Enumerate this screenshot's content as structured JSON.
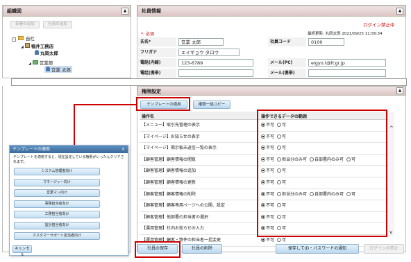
{
  "left_panel": {
    "title": "組織図",
    "buttons": [
      "部署の追加",
      "社員の追加"
    ],
    "tree": [
      {
        "label": "自社"
      },
      {
        "label": "福井工務店"
      },
      {
        "label": "丸岡太郎"
      },
      {
        "label": "営業部"
      },
      {
        "label": "営業 太郎"
      }
    ]
  },
  "employee_info": {
    "title": "社員情報",
    "login_status": "ログイン禁止中",
    "required_note": "*: 必須",
    "last_updated": "最終更新: 丸岡太郎 2021/09/25 11:56:34",
    "fields": {
      "name_label": "氏名*",
      "name_value": "営業 太郎",
      "employee_code_label": "社員コード",
      "employee_code_value": "0100",
      "furigana_label": "フリガナ",
      "furigana_value": "エイギョウ タロウ",
      "phone_internal_label": "電話(内線)",
      "phone_internal_value": "123-6789",
      "mail_pc_label": "メール(PC)",
      "mail_pc_value": "eigyo.t@fcgr.jp",
      "phone_mobile_label": "電話(携帯)",
      "phone_mobile_value": "",
      "mail_mobile_label": "メール(携帯)",
      "mail_mobile_value": ""
    }
  },
  "permissions": {
    "title": "権限設定",
    "apply_template_button": "テンプレートの適用",
    "bulk_copy_button": "権限一括コピー",
    "col_operation": "操作名",
    "col_scope": "操作できるデータの範囲",
    "rows": [
      {
        "name": "【メニュー】取引先管理の表示",
        "options": [
          "不可",
          "可"
        ],
        "selected": 0
      },
      {
        "name": "【マイページ】お知らせの表示",
        "options": [
          "不可",
          "可"
        ],
        "selected": 0
      },
      {
        "name": "【マイページ】掲示板未返信一覧の表示",
        "options": [
          "不可",
          "可"
        ],
        "selected": 0
      },
      {
        "name": "【顧客管理】顧客情報の閲覧",
        "options": [
          "不可",
          "担当分のみ可",
          "自部署内のみ可",
          "可"
        ],
        "selected": 0
      },
      {
        "name": "【顧客管理】顧客情報の追加",
        "options": [
          "不可",
          "可"
        ],
        "selected": 0
      },
      {
        "name": "【顧客管理】顧客情報の更新",
        "options": [
          "不可",
          "可"
        ],
        "selected": 0
      },
      {
        "name": "【顧客管理】顧客情報の削除",
        "options": [
          "不可",
          "担当分のみ可",
          "自部署内のみ可",
          "可"
        ],
        "selected": 0
      },
      {
        "name": "【顧客管理】顧客専用ページへの公開、設定",
        "options": [
          "不可",
          "可"
        ],
        "selected": 0
      },
      {
        "name": "【顧客管理】他部署の担当者の選択",
        "options": [
          "不可",
          "可"
        ],
        "selected": 0
      },
      {
        "name": "【運用管理】社内お知らせの入力",
        "options": [
          "不可",
          "可"
        ],
        "selected": 0
      },
      {
        "name": "【運用管理】顧客・物件の担当者一括変更",
        "options": [
          "不可",
          "可"
        ],
        "selected": 0
      }
    ]
  },
  "footer": {
    "save_employee": "社員の保存",
    "delete_employee": "社員の削除",
    "save_and_notify": "保存してID・パスワードの通知",
    "login_ban": "ログインの禁止"
  },
  "template_popup": {
    "title": "テンプレートの適用",
    "description": "テンプレートを適用すると、現在設定している権限がいったんクリアされます。",
    "templates": [
      "システム管理者向け",
      "マネージャー向け",
      "営業マン向け",
      "事務担当者向け",
      "工務担当者向け",
      "設計担当者向け",
      "カスタマーサポート担当者向け"
    ],
    "cancel": "キャンセル"
  },
  "colors": {
    "accent_red": "#cc0000",
    "panel_header": "#dcc6c6",
    "button_blue": "#c4dff2"
  }
}
